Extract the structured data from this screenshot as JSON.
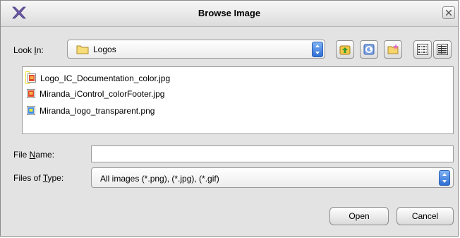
{
  "window": {
    "title": "Browse Image"
  },
  "lookin": {
    "label_pre": "Look ",
    "label_mnemonic": "I",
    "label_post": "n:",
    "value": "Logos"
  },
  "toolbar": [
    {
      "name": "up-folder-icon"
    },
    {
      "name": "home-icon"
    },
    {
      "name": "new-folder-icon"
    },
    {
      "name": "list-view-icon"
    },
    {
      "name": "details-view-icon"
    }
  ],
  "files": [
    {
      "name": "Logo_IC_Documentation_color.jpg",
      "type": "jpg",
      "selected": true
    },
    {
      "name": "Miranda_iControl_colorFooter.jpg",
      "type": "jpg",
      "selected": false
    },
    {
      "name": "Miranda_logo_transparent.png",
      "type": "png",
      "selected": false
    }
  ],
  "filename": {
    "label_pre": "File ",
    "label_mnemonic": "N",
    "label_post": "ame:",
    "value": ""
  },
  "filetype": {
    "label_pre": "Files of ",
    "label_mnemonic": "T",
    "label_post": "ype:",
    "value": "All images (*.png), (*.jpg), (*.gif)"
  },
  "buttons": {
    "open": "Open",
    "cancel": "Cancel"
  },
  "colors": {
    "dialog_bg": "#e3e3e3",
    "selection_border": "#f0df3a",
    "spinner": "#2f6fd6"
  }
}
